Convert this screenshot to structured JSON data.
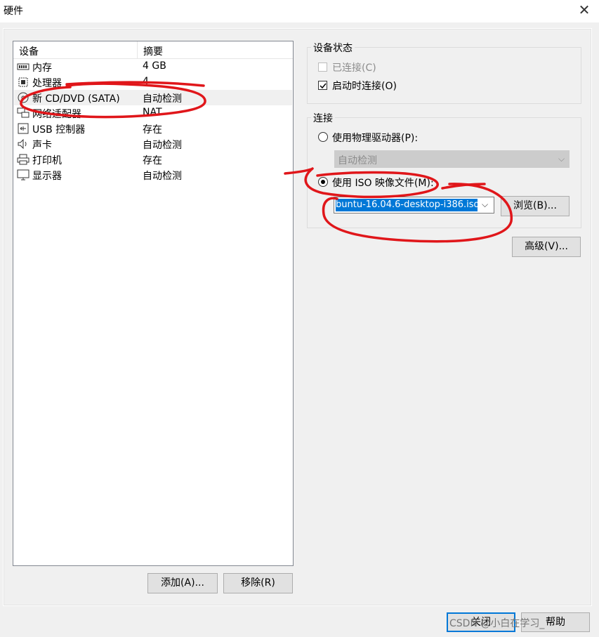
{
  "window": {
    "title": "硬件",
    "close_glyph": "✕"
  },
  "device_list": {
    "columns": [
      "设备",
      "摘要"
    ],
    "rows": [
      {
        "icon": "memory-icon",
        "name": "内存",
        "value": "4 GB"
      },
      {
        "icon": "processor-icon",
        "name": "处理器",
        "value": "4"
      },
      {
        "icon": "cd-dvd-icon",
        "name": "新 CD/DVD (SATA)",
        "value": "自动检测",
        "selected": true
      },
      {
        "icon": "network-adapter-icon",
        "name": "网络适配器",
        "value": "NAT"
      },
      {
        "icon": "usb-controller-icon",
        "name": "USB 控制器",
        "value": "存在"
      },
      {
        "icon": "sound-card-icon",
        "name": "声卡",
        "value": "自动检测"
      },
      {
        "icon": "printer-icon",
        "name": "打印机",
        "value": "存在"
      },
      {
        "icon": "display-icon",
        "name": "显示器",
        "value": "自动检测"
      }
    ]
  },
  "buttons": {
    "add": "添加(A)...",
    "remove": "移除(R)",
    "browse": "浏览(B)...",
    "advanced": "高级(V)...",
    "close": "关闭",
    "help": "帮助"
  },
  "device_status": {
    "title": "设备状态",
    "connected": {
      "label": "已连接(C)",
      "checked": false,
      "disabled": true
    },
    "connect_at_power_on": {
      "label": "启动时连接(O)",
      "checked": true
    }
  },
  "connection": {
    "title": "连接",
    "physical_drive": {
      "label": "使用物理驱动器(P):",
      "selected": false
    },
    "physical_drive_value": "自动检测",
    "iso_image": {
      "label": "使用 ISO 映像文件(M):",
      "selected": true
    },
    "iso_path": "buntu-16.04.6-desktop-i386.iso"
  },
  "watermark": "CSDN @小白在学习_",
  "annotation_color": "#e0161a"
}
